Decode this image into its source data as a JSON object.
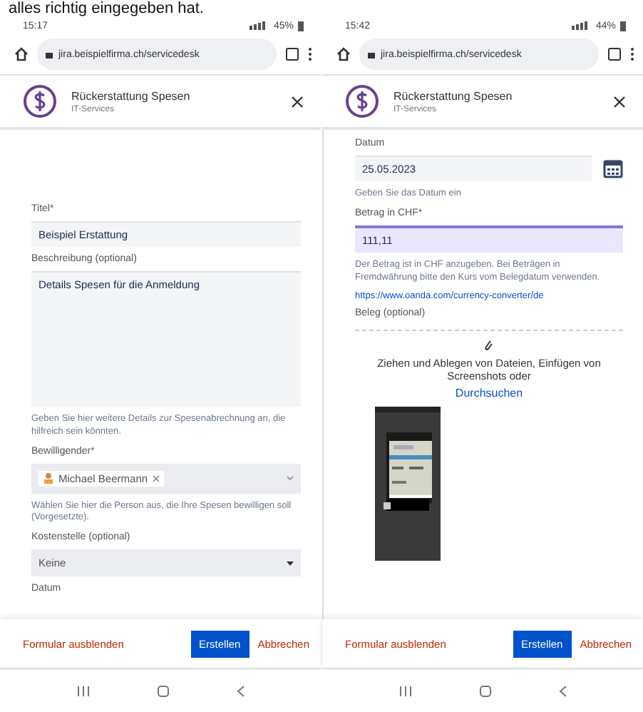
{
  "caption": "alles richtig eingegeben hat.",
  "phones": [
    {
      "status": {
        "time": "15:17",
        "battery": "45%"
      },
      "url": "jira.beispielfirma.ch/servicedesk",
      "header": {
        "title": "Rückerstattung Spesen",
        "subtitle": "IT-Services"
      },
      "footer": {
        "hide": "Formular ausblenden",
        "create": "Erstellen",
        "cancel": "Abbrechen"
      },
      "fields": [
        {
          "kind": "text",
          "label": "Titel*",
          "value": "Beispiel Erstattung"
        },
        {
          "kind": "textarea",
          "label": "Beschreibung (optional)",
          "value": "Details Spesen für die Anmeldung",
          "help": "Geben Sie hier weitere Details zur Spesenabrechnung an, die hilfreich sein könnten."
        },
        {
          "kind": "people",
          "label": "Bewilligender*",
          "value": "Michael Beermann",
          "help": "Wählen Sie hier die Person aus, die Ihre Spesen bewilligen soll (Vorgesetzte)."
        },
        {
          "kind": "select",
          "label": "Kostenstelle (optional)",
          "value": "Keine"
        },
        {
          "kind": "label",
          "label": "Datum"
        }
      ]
    },
    {
      "status": {
        "time": "15:42",
        "battery": "44%"
      },
      "url": "jira.beispielfirma.ch/servicedesk",
      "header": {
        "title": "Rückerstattung Spesen",
        "subtitle": "IT-Services"
      },
      "footer": {
        "hide": "Formular ausblenden",
        "create": "Erstellen",
        "cancel": "Abbrechen"
      },
      "fields": [
        {
          "kind": "date",
          "label": "Datum",
          "value": "25.05.2023",
          "help": "Geben Sie das Datum ein"
        },
        {
          "kind": "amount",
          "label": "Betrag in CHF*",
          "value": "111,11",
          "focused": true,
          "help": "Der Betrag ist in CHF anzugeben. Bei Beträgen in Fremdwährung bitte den Kurs vom Belegdatum verwenden.",
          "link": "https://www.oanda.com/currency-converter/de"
        },
        {
          "kind": "upload",
          "label": "Beleg (optional)",
          "text": "Ziehen und Ablegen von Dateien, Einfügen von Screenshots oder",
          "link": "Durchsuchen"
        }
      ]
    }
  ]
}
